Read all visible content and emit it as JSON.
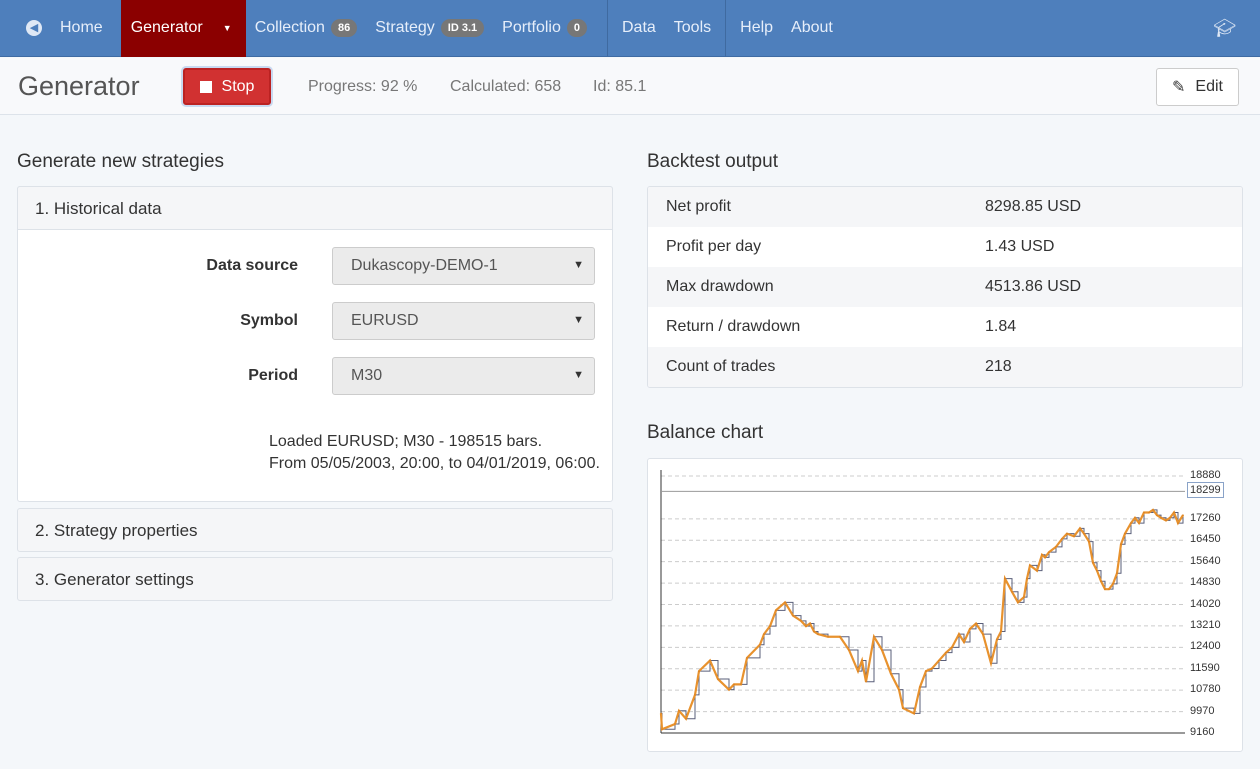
{
  "nav": {
    "home": "Home",
    "generator": "Generator",
    "collection": "Collection",
    "collection_badge": "86",
    "strategy": "Strategy",
    "strategy_badge": "ID 3.1",
    "portfolio": "Portfolio",
    "portfolio_badge": "0",
    "data": "Data",
    "tools": "Tools",
    "help": "Help",
    "about": "About"
  },
  "header": {
    "title": "Generator",
    "stop": "Stop",
    "progress": "Progress: 92 %",
    "calculated": "Calculated: 658",
    "id": "Id: 85.1",
    "edit": "Edit",
    "progress_value": 92
  },
  "left": {
    "title": "Generate new strategies",
    "sections": [
      "1. Historical data",
      "2. Strategy properties",
      "3. Generator settings"
    ],
    "fields": [
      {
        "label": "Data source",
        "value": "Dukascopy-DEMO-1"
      },
      {
        "label": "Symbol",
        "value": "EURUSD"
      },
      {
        "label": "Period",
        "value": "M30"
      }
    ],
    "loaded1": "Loaded EURUSD; M30 - 198515 bars.",
    "loaded2": "From 05/05/2003, 20:00, to 04/01/2019, 06:00."
  },
  "backtest": {
    "title": "Backtest output",
    "rows": [
      {
        "k": "Net profit",
        "v": "8298.85 USD"
      },
      {
        "k": "Profit per day",
        "v": "1.43 USD"
      },
      {
        "k": "Max drawdown",
        "v": "4513.86 USD"
      },
      {
        "k": "Return / drawdown",
        "v": "1.84"
      },
      {
        "k": "Count of trades",
        "v": "218"
      }
    ]
  },
  "chart_data": {
    "type": "line",
    "title": "Balance chart",
    "ylim": [
      9160,
      18880
    ],
    "y_ticks": [
      "18880",
      "17260",
      "16450",
      "15640",
      "14830",
      "14020",
      "13210",
      "12400",
      "11590",
      "10780",
      "9970",
      "9160"
    ],
    "current_label": "18299",
    "current": 18299,
    "xlim": [
      0,
      218
    ],
    "x": [
      0,
      1,
      14,
      18,
      25,
      34,
      38,
      49,
      57,
      68,
      73,
      80,
      86,
      99,
      103,
      109,
      115,
      124,
      132,
      140,
      145,
      149,
      153,
      157,
      167,
      179,
      188,
      197,
      201,
      205,
      213,
      221,
      230,
      238,
      242,
      253,
      259,
      265,
      271,
      278,
      285,
      291,
      298,
      303,
      309,
      315,
      322,
      330,
      336,
      340,
      344,
      351,
      357,
      363,
      366,
      369,
      376,
      381,
      384,
      388,
      395,
      401,
      406,
      413,
      419,
      423,
      428,
      432,
      436,
      440,
      444,
      448,
      452,
      456,
      460,
      464,
      470,
      474,
      478,
      483,
      488,
      492,
      496,
      500,
      505,
      509,
      513,
      517,
      522
    ],
    "y": [
      9900,
      9300,
      9500,
      10000,
      9700,
      10600,
      11500,
      11900,
      11200,
      10800,
      11000,
      11000,
      12000,
      12500,
      12900,
      13200,
      13800,
      14100,
      13600,
      13400,
      13200,
      13300,
      13000,
      12900,
      12800,
      12800,
      12300,
      11500,
      11900,
      11100,
      12800,
      12300,
      11400,
      10800,
      10100,
      9900,
      10900,
      11500,
      11600,
      11900,
      12200,
      12400,
      12900,
      12600,
      13100,
      13300,
      12900,
      11800,
      12700,
      13000,
      15000,
      14500,
      14100,
      14300,
      15000,
      15500,
      15300,
      15900,
      15800,
      16000,
      16200,
      16500,
      16700,
      16600,
      16900,
      16700,
      16400,
      15600,
      15300,
      14900,
      14600,
      14600,
      14800,
      15200,
      16300,
      16700,
      17100,
      17300,
      17100,
      17500,
      17500,
      17600,
      17400,
      17300,
      17200,
      17300,
      17500,
      17100,
      17400
    ]
  }
}
